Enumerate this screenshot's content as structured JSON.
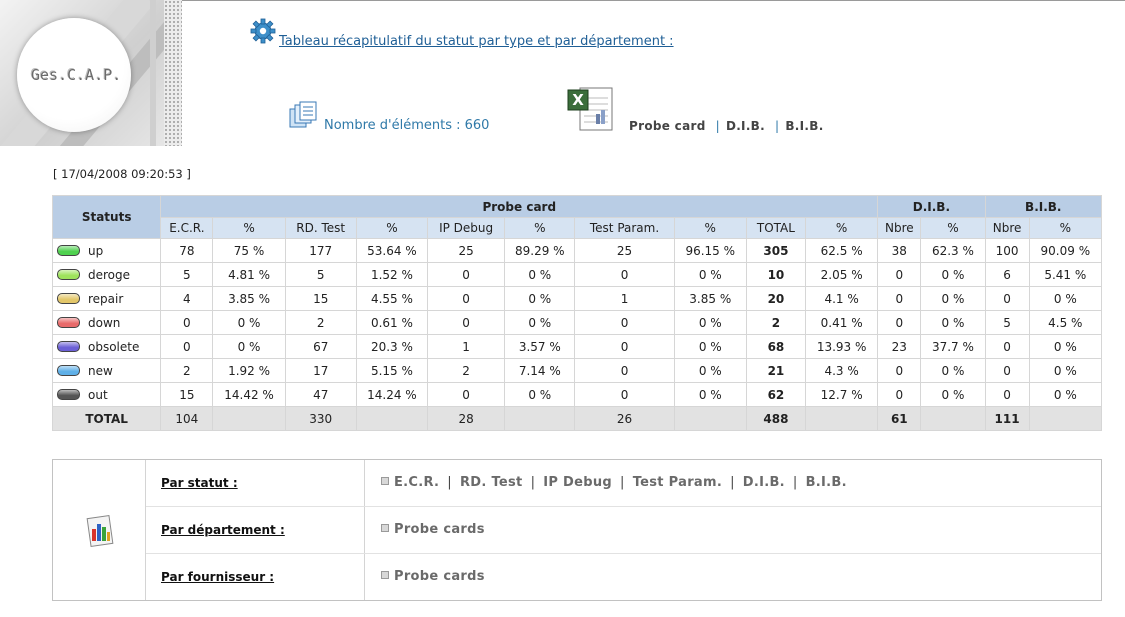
{
  "logo": {
    "text": "Ges.C.A.P."
  },
  "header": {
    "title_link": "Tableau récapitulatif du statut par type et par département :",
    "count_text": "Nombre d'éléments : 660",
    "excel_links": [
      "Probe card",
      "D.I.B.",
      "B.I.B."
    ]
  },
  "timestamp": "[ 17/04/2008 09:20:53 ]",
  "table": {
    "statuts_header": "Statuts",
    "group_headers": [
      "Probe card",
      "D.I.B.",
      "B.I.B."
    ],
    "sub_headers": [
      "E.C.R.",
      "%",
      "RD. Test",
      "%",
      "IP Debug",
      "%",
      "Test Param.",
      "%",
      "TOTAL",
      "%",
      "Nbre",
      "%",
      "Nbre",
      "%"
    ],
    "rows": [
      {
        "label": "up",
        "color": "#4fd14f",
        "cells": [
          "78",
          "75 %",
          "177",
          "53.64 %",
          "25",
          "89.29 %",
          "25",
          "96.15 %",
          "305",
          "62.5 %",
          "38",
          "62.3 %",
          "100",
          "90.09 %"
        ]
      },
      {
        "label": "deroge",
        "color": "#9ee35c",
        "cells": [
          "5",
          "4.81 %",
          "5",
          "1.52 %",
          "0",
          "0 %",
          "0",
          "0 %",
          "10",
          "2.05 %",
          "0",
          "0 %",
          "6",
          "5.41 %"
        ]
      },
      {
        "label": "repair",
        "color": "#e3c76a",
        "cells": [
          "4",
          "3.85 %",
          "15",
          "4.55 %",
          "0",
          "0 %",
          "1",
          "3.85 %",
          "20",
          "4.1 %",
          "0",
          "0 %",
          "0",
          "0 %"
        ]
      },
      {
        "label": "down",
        "color": "#e86a6a",
        "cells": [
          "0",
          "0 %",
          "2",
          "0.61 %",
          "0",
          "0 %",
          "0",
          "0 %",
          "2",
          "0.41 %",
          "0",
          "0 %",
          "5",
          "4.5 %"
        ]
      },
      {
        "label": "obsolete",
        "color": "#6b5fd6",
        "cells": [
          "0",
          "0 %",
          "67",
          "20.3 %",
          "1",
          "3.57 %",
          "0",
          "0 %",
          "68",
          "13.93 %",
          "23",
          "37.7 %",
          "0",
          "0 %"
        ]
      },
      {
        "label": "new",
        "color": "#5fb0e8",
        "cells": [
          "2",
          "1.92 %",
          "17",
          "5.15 %",
          "2",
          "7.14 %",
          "0",
          "0 %",
          "21",
          "4.3 %",
          "0",
          "0 %",
          "0",
          "0 %"
        ]
      },
      {
        "label": "out",
        "color": "#555555",
        "cells": [
          "15",
          "14.42 %",
          "47",
          "14.24 %",
          "0",
          "0 %",
          "0",
          "0 %",
          "62",
          "12.7 %",
          "0",
          "0 %",
          "0",
          "0 %"
        ]
      }
    ],
    "total": {
      "label": "TOTAL",
      "cells": [
        "104",
        "",
        "330",
        "",
        "28",
        "",
        "26",
        "",
        "488",
        "",
        "61",
        "",
        "111",
        ""
      ]
    }
  },
  "nav": {
    "rows": [
      {
        "label": "Par statut :",
        "links": [
          "E.C.R.",
          "RD. Test",
          "IP Debug",
          "Test Param.",
          "D.I.B.",
          "B.I.B."
        ]
      },
      {
        "label": "Par département :",
        "links": [
          "Probe cards"
        ]
      },
      {
        "label": "Par fournisseur :",
        "links": [
          "Probe cards"
        ]
      }
    ]
  }
}
